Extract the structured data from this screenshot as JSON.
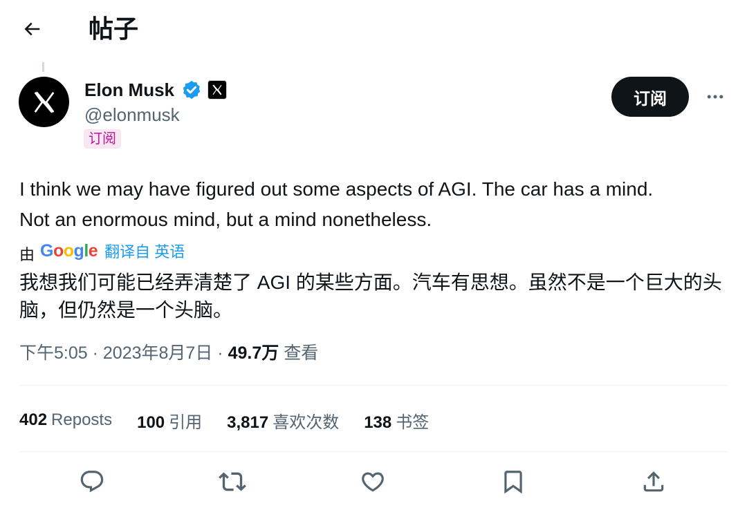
{
  "header": {
    "title": "帖子"
  },
  "author": {
    "display_name": "Elon Musk",
    "handle": "@elonmusk",
    "subscription_badge": "订阅",
    "verified_color": "#1d9bf0"
  },
  "actions_top": {
    "subscribe_label": "订阅"
  },
  "tweet": {
    "text_line1": "I think we may have figured out some aspects of AGI. The car has a mind.",
    "text_line2": "Not an enormous mind, but a mind nonetheless.",
    "translate_by": "由",
    "translate_provider": "Google",
    "translate_from": "翻译自 英语",
    "translated_text": "我想我们可能已经弄清楚了 AGI 的某些方面。汽车有思想。虽然不是一个巨大的头脑，但仍然是一个头脑。"
  },
  "meta": {
    "time": "下午5:05",
    "separator": "·",
    "date": "2023年8月7日",
    "views_count": "49.7万",
    "views_label": "查看"
  },
  "stats": {
    "reposts_count": "402",
    "reposts_label": "Reposts",
    "quotes_count": "100",
    "quotes_label": "引用",
    "likes_count": "3,817",
    "likes_label": "喜欢次数",
    "bookmarks_count": "138",
    "bookmarks_label": "书签"
  },
  "icons": {
    "back": "arrow-left-icon",
    "more": "more-horizontal-icon",
    "reply": "reply-icon",
    "repost": "repost-icon",
    "like": "heart-icon",
    "bookmark": "bookmark-icon",
    "share": "share-icon"
  },
  "colors": {
    "accent": "#1d9bf0",
    "secondary_text": "#536471",
    "badge_bg": "#f8e6f3",
    "badge_text": "#b8179a"
  }
}
